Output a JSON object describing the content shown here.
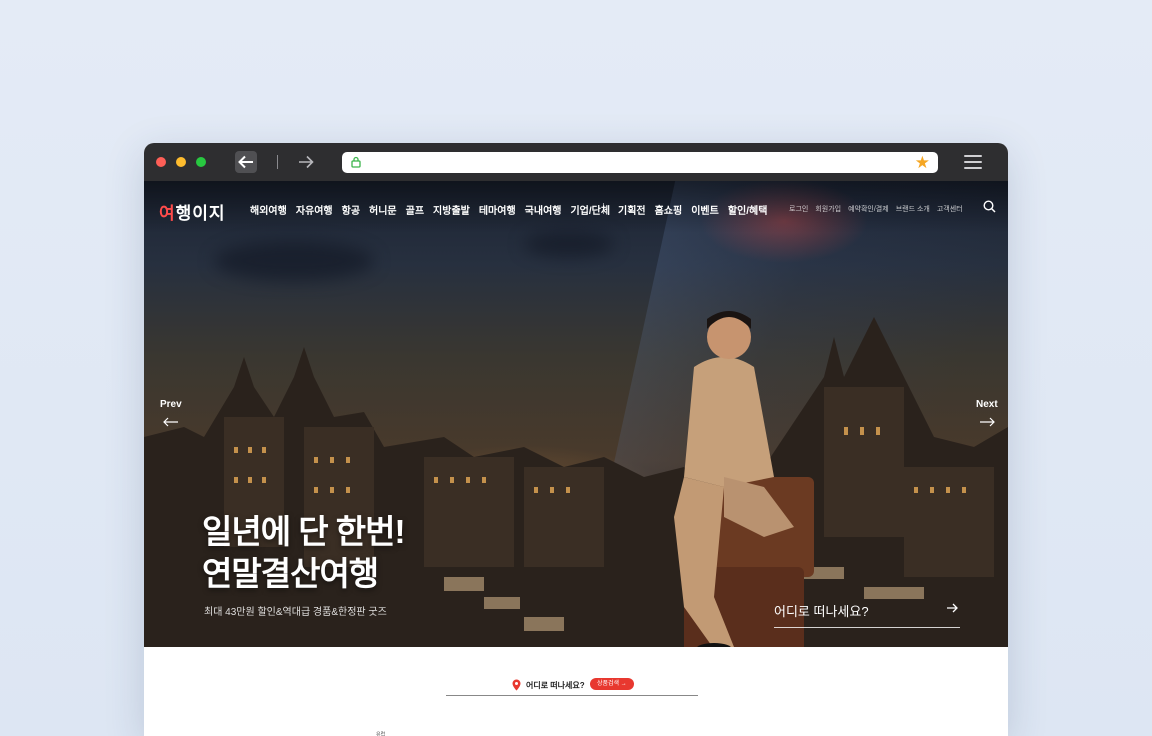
{
  "browser": {
    "address_value": ""
  },
  "site": {
    "logo_text_a": "여",
    "logo_text_b": "행이지",
    "main_nav": [
      "해외여행",
      "자유여행",
      "항공",
      "허니문",
      "골프",
      "지방출발",
      "테마여행",
      "국내여행",
      "기업/단체"
    ],
    "sub_nav": [
      "기획전",
      "홈쇼핑",
      "이벤트",
      "할인/혜택"
    ],
    "utility_nav": [
      "로그인",
      "회원가입",
      "예약확인/결제",
      "브랜드 소개",
      "고객센터"
    ]
  },
  "hero": {
    "prev_label": "Prev",
    "next_label": "Next",
    "headline_line1": "일년에 단 한번!",
    "headline_line2": "연말결산여행",
    "subline": "최대 43만원 할인&역대급 경품&한정판 굿즈",
    "where_prompt": "어디로 떠나세요?"
  },
  "search": {
    "label": "어디로 떠나세요?",
    "button_label": "상품검색 →"
  },
  "below_text": "유럽",
  "colors": {
    "accent_red": "#e8382f",
    "star": "#f5a623"
  }
}
